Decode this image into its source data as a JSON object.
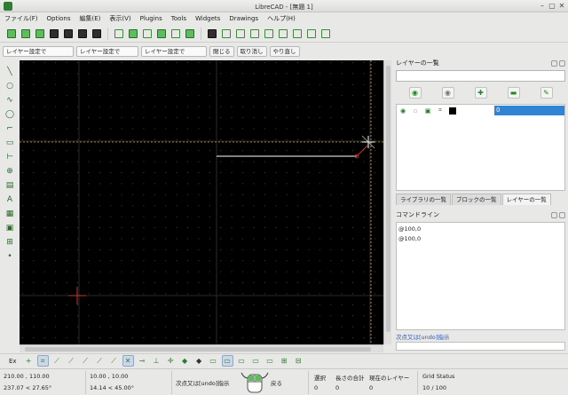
{
  "window": {
    "title": "LibreCAD - [無題 1]"
  },
  "menu": [
    "ファイル(F)",
    "Options",
    "編集(E)",
    "表示(V)",
    "Plugins",
    "Tools",
    "Widgets",
    "Drawings",
    "ヘルプ(H)"
  ],
  "pen_toolbar": {
    "color_combo": "レイヤー設定で",
    "width_combo": "レイヤー設定で",
    "type_combo": "レイヤー設定で",
    "close_button": "閉じる",
    "undo_button": "取り消し",
    "redo_button": "やり直し"
  },
  "layer_panel": {
    "title": "レイヤーの一覧",
    "filter_value": "",
    "layers": [
      {
        "name": "0",
        "color": "#000000"
      }
    ]
  },
  "tabs": [
    "ライブラリの一覧",
    "ブロックの一覧",
    "レイヤーの一覧"
  ],
  "active_tab": "レイヤーの一覧",
  "command_line": {
    "title": "コマンドライン",
    "history": [
      "@100,0",
      "@100,0"
    ],
    "prompt": "次点又は[undo]指示"
  },
  "snap_toolbar": {
    "label": "Ex"
  },
  "status": {
    "abs_coord": "210.00 , 110.00",
    "abs_polar": "237.07 < 27.65°",
    "rel_coord": "10.00 , 10.00",
    "rel_polar": "14.14 < 45.00°",
    "mouse_left": "次点又は[undo]指示",
    "mouse_right": "戻る",
    "selected_label": "選択",
    "selected_value": "0",
    "length_label": "長さの合計",
    "length_value": "0",
    "current_layer_label": "現在のレイヤー",
    "current_layer_value": "0",
    "grid_label": "Grid Status",
    "grid_value": "10 / 100"
  },
  "colors": {
    "canvas_bg": "#000000",
    "grid_dot": "#444444",
    "crosshair": "#c9a24a",
    "origin": "#c0392b",
    "entity_line": "#ffffff",
    "selection_accent": "#2f84d6"
  }
}
